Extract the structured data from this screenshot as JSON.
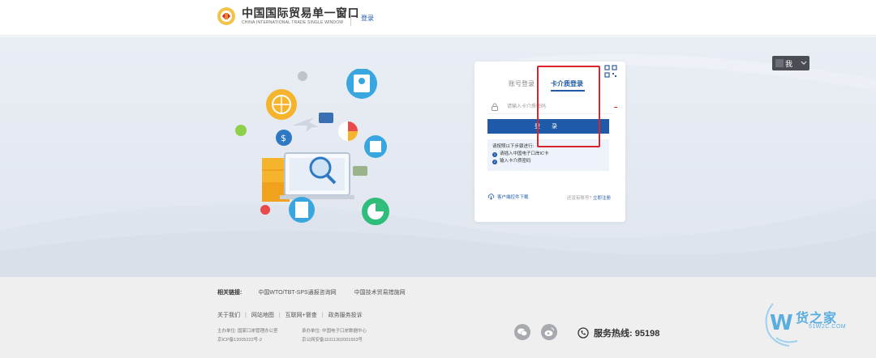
{
  "header": {
    "brand_cn": "中国国际贸易单一窗口",
    "brand_en": "CHINA INTERNATIONAL TRADE SINGLE WINDOW",
    "login_link": "登录"
  },
  "login": {
    "tabs": [
      "账号登录",
      "卡介质登录"
    ],
    "active_tab": 1,
    "password_placeholder": "请输入卡介质密码",
    "login_button": "登 录",
    "steps_title": "请按照以下步骤进行:",
    "steps": [
      "请插入中国电子口岸IC卡",
      "输入卡介质密码"
    ],
    "download_link": "客户端控件下载",
    "register_prompt": "还没有账号?",
    "register_link": "立即注册"
  },
  "footer": {
    "links_label": "相关链接:",
    "links": [
      "中国WTO/TBT-SPS通报咨询网",
      "中国技术贸易措施网"
    ],
    "nav": [
      "关于我们",
      "网站地图",
      "互联网+督查",
      "政务服务投诉"
    ],
    "info_col1": [
      "主办单位: 国家口岸管理办公室",
      "京ICP备12005222号-2"
    ],
    "info_col2": [
      "承办单位: 中国电子口岸数据中心",
      "京公网安备11011302001653号"
    ],
    "hotline": "服务热线: 95198"
  },
  "watermark": {
    "cn": "货之家",
    "en": "51W2C.COM"
  },
  "colors": {
    "primary": "#1e5aa8",
    "highlight": "#d8242b",
    "hero_bg": "#e6ebf2",
    "footer_bg": "#efefef"
  }
}
